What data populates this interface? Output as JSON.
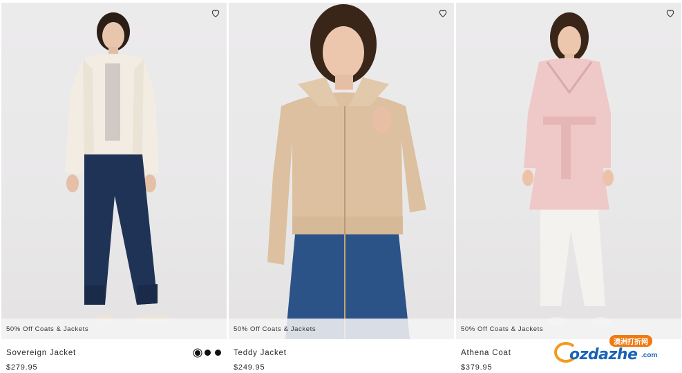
{
  "products": [
    {
      "promo": "50% Off Coats & Jackets",
      "name": "Sovereign Jacket",
      "price": "$279.95",
      "swatches": [
        "#111111",
        "#111111",
        "#111111"
      ],
      "wishlist_icon": "heart-outline-icon"
    },
    {
      "promo": "50% Off Coats & Jackets",
      "name": "Teddy Jacket",
      "price": "$249.95",
      "wishlist_icon": "heart-outline-icon"
    },
    {
      "promo": "50% Off Coats & Jackets",
      "name": "Athena Coat",
      "price": "$379.95",
      "wishlist_icon": "heart-outline-icon"
    }
  ],
  "watermark": {
    "brand": "ozdazhe",
    "tld": ".com",
    "tag": "澳洲打折网"
  }
}
